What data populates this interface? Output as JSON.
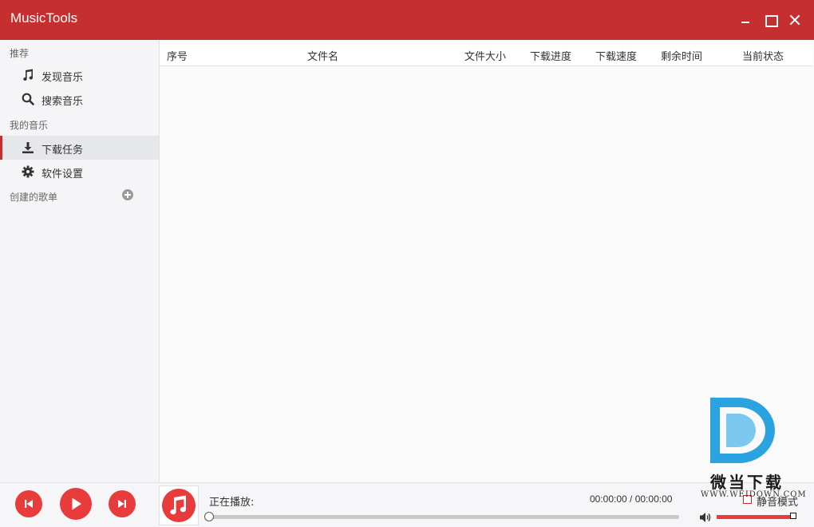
{
  "app": {
    "title": "MusicTools"
  },
  "sidebar": {
    "sections": [
      {
        "label": "推荐"
      },
      {
        "label": "我的音乐"
      },
      {
        "label": "创建的歌单"
      }
    ],
    "items": [
      {
        "label": "发现音乐",
        "icon": "music-note-icon"
      },
      {
        "label": "搜索音乐",
        "icon": "search-icon"
      },
      {
        "label": "下载任务",
        "icon": "download-icon",
        "active": true
      },
      {
        "label": "软件设置",
        "icon": "gear-icon"
      }
    ]
  },
  "table": {
    "columns": [
      "序号",
      "文件名",
      "文件大小",
      "下载进度",
      "下载速度",
      "剩余时间",
      "当前状态"
    ],
    "rows": []
  },
  "player": {
    "now_playing_label": "正在播放:",
    "time": "00:00:00 / 00:00:00",
    "progress": 0,
    "mute_label": "静音模式",
    "muted": false,
    "volume": 1.0
  },
  "watermark": {
    "text": "微当下载",
    "url": "WWW.WEIDOWN.COM"
  },
  "colors": {
    "accent": "#c62f2f",
    "button": "#e83c3c",
    "logo_blue": "#2aa3e0"
  }
}
